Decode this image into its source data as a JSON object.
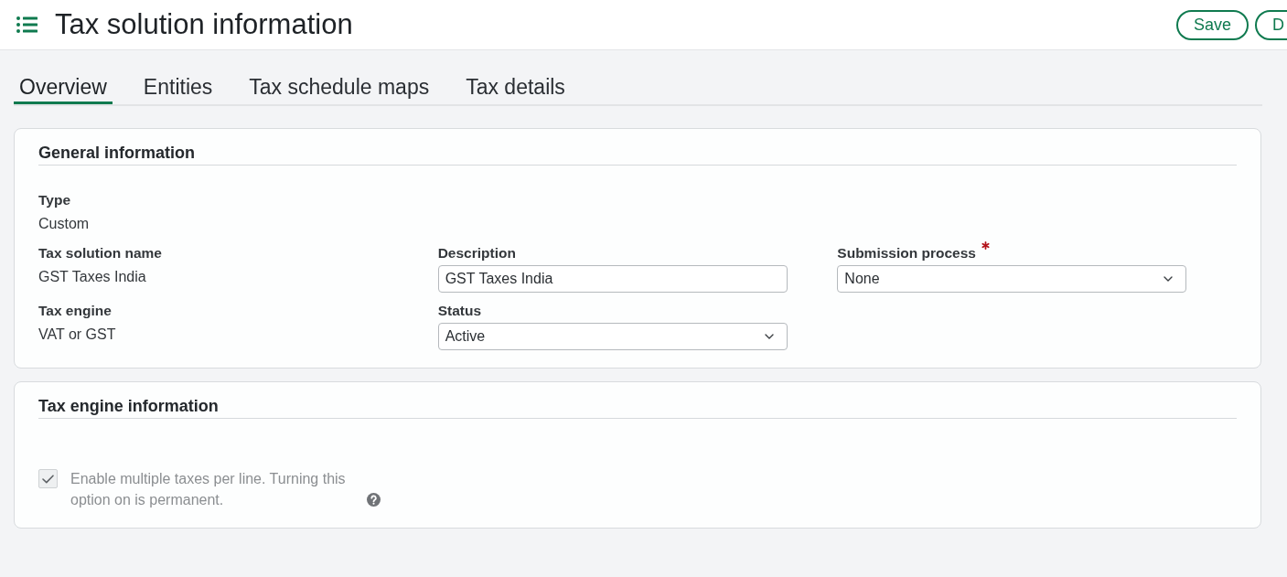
{
  "header": {
    "title": "Tax solution information",
    "buttons": [
      {
        "label": "Save"
      },
      {
        "label": "D"
      }
    ]
  },
  "tabs": [
    {
      "label": "Overview",
      "selected": true
    },
    {
      "label": "Entities",
      "selected": false
    },
    {
      "label": "Tax schedule maps",
      "selected": false
    },
    {
      "label": "Tax details",
      "selected": false
    }
  ],
  "sections": [
    {
      "title": "General information",
      "rows": [
        {
          "fields": [
            {
              "kind": "readonly",
              "label": "Type",
              "value": "Custom",
              "required": false
            }
          ]
        },
        {
          "fields": [
            {
              "kind": "readonly",
              "label": "Tax solution name",
              "value": "GST Taxes India",
              "required": false
            },
            {
              "kind": "text",
              "label": "Description",
              "value": "GST Taxes India",
              "required": false
            },
            {
              "kind": "select",
              "label": "Submission process",
              "value": "None",
              "required": true
            }
          ]
        },
        {
          "fields": [
            {
              "kind": "readonly",
              "label": "Tax engine",
              "value": "VAT or GST",
              "required": false
            },
            {
              "kind": "select",
              "label": "Status",
              "value": "Active",
              "required": false
            }
          ]
        }
      ]
    },
    {
      "title": "Tax engine information",
      "options": [
        {
          "kind": "checkbox",
          "label": "Enable multiple taxes per line. Turning this option on is permanent.",
          "checked": true,
          "disabled": true,
          "help": true
        }
      ]
    }
  ]
}
